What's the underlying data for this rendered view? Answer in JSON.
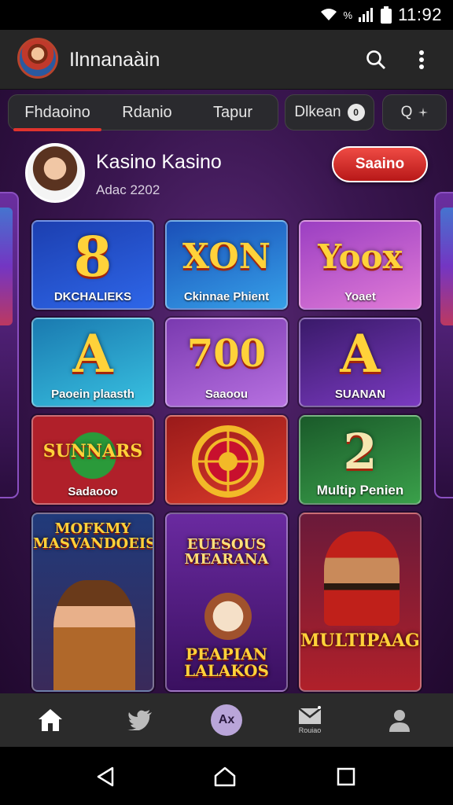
{
  "status": {
    "time": "11:92",
    "signal_text": "%"
  },
  "appbar": {
    "title": "Ilnnanaàin"
  },
  "tabs": [
    {
      "label": "Fhdaoino"
    },
    {
      "label": "Rdanio"
    },
    {
      "label": "Tapur"
    }
  ],
  "chips": {
    "filter_label": "Dlkean",
    "filter_badge": "0",
    "search_label": "Q"
  },
  "profile": {
    "name": "Kasino Kasino",
    "subtitle": "Adac 2202",
    "cta_label": "Saaino"
  },
  "games": [
    {
      "art": "8",
      "caption": "DKCHALIEKS",
      "colors": [
        "#1c3fb0",
        "#2e66e8"
      ]
    },
    {
      "art": "XON",
      "caption": "Ckinnae Phient",
      "colors": [
        "#1a4fb8",
        "#36a0e8"
      ]
    },
    {
      "art": "Yoox",
      "caption": "Yoaet",
      "colors": [
        "#9b3fc2",
        "#e07ad6"
      ]
    },
    {
      "art": "A",
      "caption": "Paoein plaasth",
      "colors": [
        "#1a7ab0",
        "#38c0e0"
      ]
    },
    {
      "art": "700",
      "caption": "Saaoou",
      "colors": [
        "#7a3ab0",
        "#b770e0"
      ]
    },
    {
      "art": "A",
      "caption": "SUANAN",
      "colors": [
        "#3a1a6a",
        "#7a3ac0"
      ]
    },
    {
      "art": "SUNNARS",
      "caption": "Sadaooo",
      "colors": [
        "#b0202a",
        "#e04a2a"
      ]
    },
    {
      "art": "",
      "caption": "",
      "colors": [
        "#9a1a1a",
        "#d83a2a"
      ]
    },
    {
      "art": "2",
      "caption": "Multip Penien",
      "colors": [
        "#1a5a2a",
        "#3aa04a"
      ]
    }
  ],
  "featured": [
    {
      "title": "MOFKMY MASVANDOEIS",
      "colors": [
        "#203a7a",
        "#3a2a5a"
      ]
    },
    {
      "title_top": "EUESOUS MEARANA",
      "title_bottom": "PEAPIAN LALAKOS",
      "colors": [
        "#6a2aa0",
        "#3a1060"
      ]
    },
    {
      "title": "MULTIPAAGS",
      "colors": [
        "#6a1a3a",
        "#b0202a"
      ]
    }
  ],
  "bottomnav": {
    "ax_label": "Ax",
    "mail_label": "Rouiao"
  },
  "icons": [
    "wifi-icon",
    "signal-icon",
    "battery-icon",
    "search-icon",
    "more-vert-icon",
    "home-icon",
    "bird-icon",
    "mail-icon",
    "person-icon",
    "back-icon",
    "home-circle-icon",
    "recents-icon"
  ]
}
